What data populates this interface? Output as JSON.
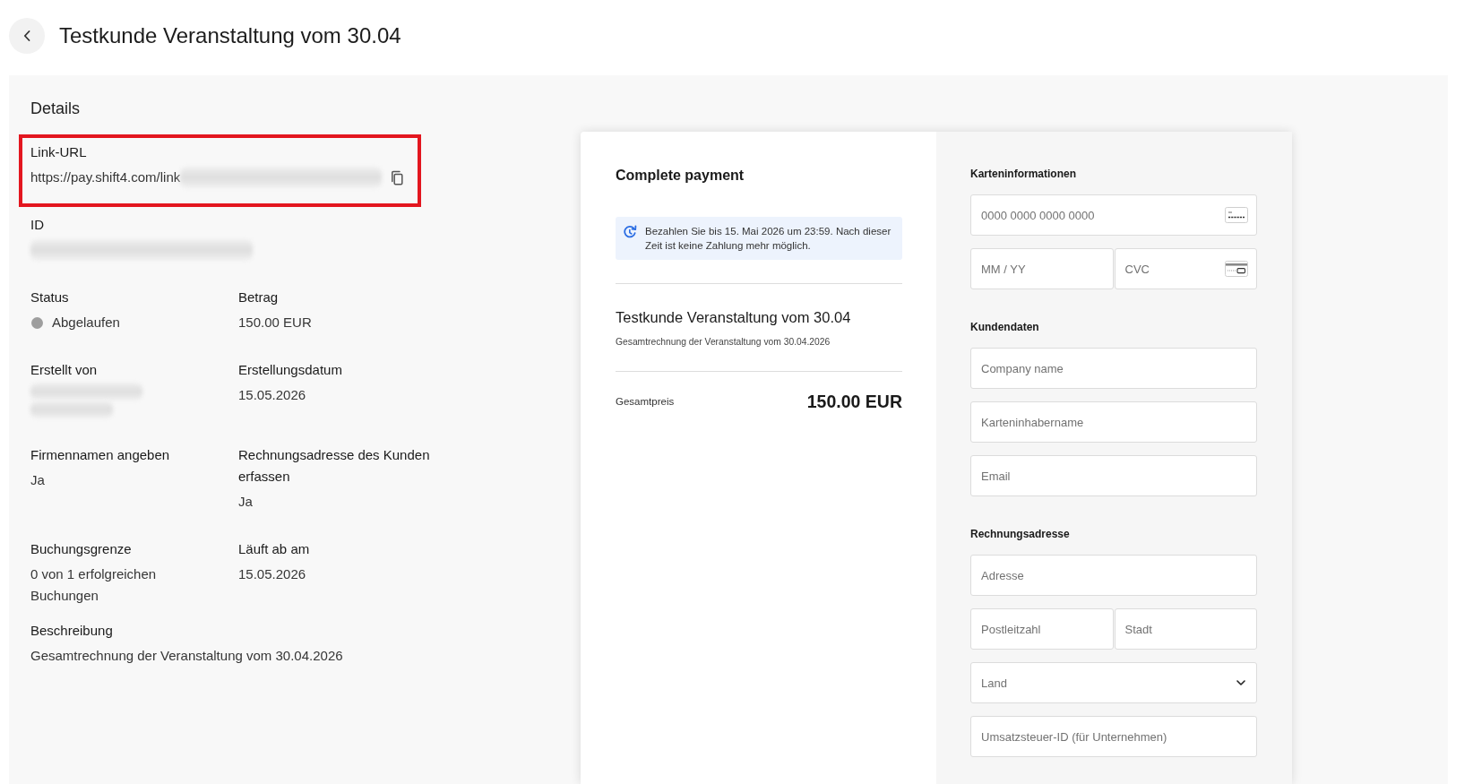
{
  "header": {
    "title": "Testkunde Veranstaltung vom 30.04"
  },
  "details": {
    "title": "Details",
    "fields": [
      {
        "kind": "wide",
        "label": "Link-URL",
        "highlighted": true,
        "copyable": true,
        "value": [
          {
            "kind": "text",
            "text": "https://pay.shift4.com/link"
          },
          {
            "kind": "blurred"
          }
        ]
      },
      {
        "kind": "wide",
        "label": "ID",
        "highlighted": false,
        "copyable": false,
        "value": [
          {
            "kind": "blurred"
          }
        ]
      },
      {
        "kind": "half",
        "label": "Status",
        "highlighted": false,
        "copyable": false,
        "value": [
          {
            "kind": "status",
            "text": "Abgelaufen",
            "color": "#9e9e9e"
          }
        ]
      },
      {
        "kind": "half",
        "label": "Betrag",
        "highlighted": false,
        "copyable": false,
        "value": [
          {
            "kind": "text",
            "text": "150.00 EUR"
          }
        ]
      },
      {
        "kind": "half",
        "label": "Erstellt von",
        "highlighted": false,
        "copyable": false,
        "value": [
          {
            "kind": "blurred"
          },
          {
            "kind": "blurred"
          }
        ]
      },
      {
        "kind": "half",
        "label": "Erstellungsdatum",
        "highlighted": false,
        "copyable": false,
        "value": [
          {
            "kind": "text",
            "text": "15.05.2026"
          }
        ]
      },
      {
        "kind": "half",
        "label": "Firmennamen angeben",
        "highlighted": false,
        "copyable": false,
        "value": [
          {
            "kind": "text",
            "text": "Ja"
          }
        ]
      },
      {
        "kind": "half",
        "label": "Rechnungsadresse des Kunden erfassen",
        "highlighted": false,
        "copyable": false,
        "value": [
          {
            "kind": "text",
            "text": "Ja"
          }
        ]
      },
      {
        "kind": "half",
        "label": "Buchungsgrenze",
        "highlighted": false,
        "copyable": false,
        "value": [
          {
            "kind": "text",
            "text": "0 von 1 erfolgreichen Buchungen"
          }
        ]
      },
      {
        "kind": "half",
        "label": "Läuft ab am",
        "highlighted": false,
        "copyable": false,
        "value": [
          {
            "kind": "text",
            "text": "15.05.2026"
          }
        ]
      },
      {
        "kind": "wide",
        "label": "Beschreibung",
        "highlighted": false,
        "copyable": false,
        "value": [
          {
            "kind": "text",
            "text": "Gesamtrechnung der Veranstaltung vom 30.04.2026"
          }
        ]
      }
    ]
  },
  "payment_preview": {
    "title": "Complete payment",
    "notice": "Bezahlen Sie bis 15. Mai 2026 um 23:59. Nach dieser Zeit ist keine Zahlung mehr möglich.",
    "item_title": "Testkunde Veranstaltung vom 30.04",
    "item_description": "Gesamtrechnung der Veranstaltung vom 30.04.2026",
    "total_label": "Gesamtpreis",
    "total": "150.00 EUR",
    "form_sections": [
      {
        "heading": "Karteninformationen",
        "rows": [
          {
            "fields": [
              {
                "kind": "card_number",
                "placeholder": "0000 0000 0000 0000"
              }
            ]
          },
          {
            "fields": [
              {
                "kind": "text",
                "placeholder": "MM / YY"
              },
              {
                "kind": "cvc",
                "placeholder": "CVC"
              }
            ]
          }
        ]
      },
      {
        "heading": "Kundendaten",
        "rows": [
          {
            "fields": [
              {
                "kind": "text",
                "placeholder": "Company name"
              }
            ]
          },
          {
            "fields": [
              {
                "kind": "text",
                "placeholder": "Karteninhabername"
              }
            ]
          },
          {
            "fields": [
              {
                "kind": "text",
                "placeholder": "Email"
              }
            ]
          }
        ]
      },
      {
        "heading": "Rechnungsadresse",
        "rows": [
          {
            "fields": [
              {
                "kind": "text",
                "placeholder": "Adresse"
              }
            ]
          },
          {
            "fields": [
              {
                "kind": "text",
                "placeholder": "Postleitzahl"
              },
              {
                "kind": "text",
                "placeholder": "Stadt"
              }
            ]
          },
          {
            "fields": [
              {
                "kind": "select",
                "placeholder": "Land"
              }
            ]
          },
          {
            "fields": [
              {
                "kind": "text",
                "placeholder": "Umsatzsteuer-ID (für Unternehmen)"
              }
            ]
          }
        ]
      }
    ]
  }
}
